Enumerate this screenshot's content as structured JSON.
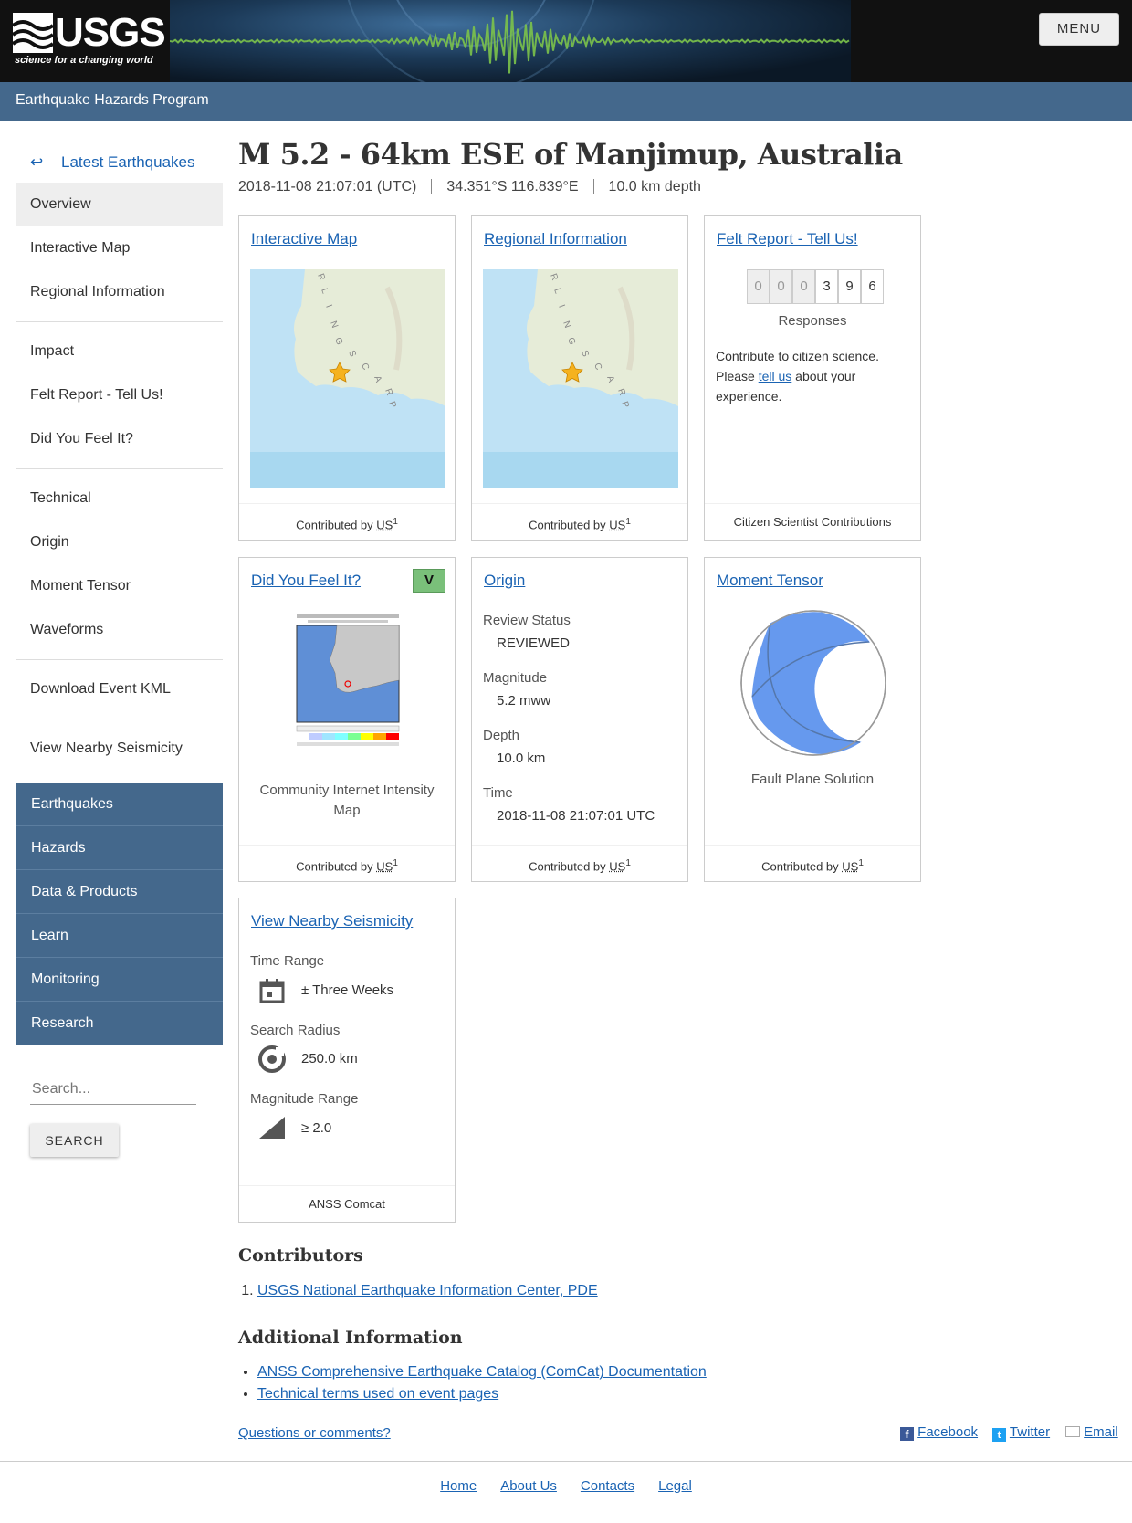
{
  "header": {
    "logo_word": "USGS",
    "logo_tagline": "science for a changing world",
    "menu_label": "MENU",
    "program": "Earthquake Hazards Program"
  },
  "sidebar": {
    "back_label": "Latest Earthquakes",
    "groups": [
      [
        "Overview",
        "Interactive Map",
        "Regional Information"
      ],
      [
        "Impact",
        "Felt Report - Tell Us!",
        "Did You Feel It?"
      ],
      [
        "Technical",
        "Origin",
        "Moment Tensor",
        "Waveforms"
      ],
      [
        "Download Event KML"
      ],
      [
        "View Nearby Seismicity"
      ]
    ],
    "active": "Overview",
    "nav": [
      "Earthquakes",
      "Hazards",
      "Data & Products",
      "Learn",
      "Monitoring",
      "Research"
    ],
    "search_placeholder": "Search...",
    "search_button": "SEARCH"
  },
  "event": {
    "title": "M 5.2 - 64km ESE of Manjimup, Australia",
    "time": "2018-11-08 21:07:01 (UTC)",
    "location": "34.351°S 116.839°E",
    "depth": "10.0 km depth"
  },
  "cards": {
    "interactive_map": {
      "title": "Interactive Map",
      "contributed": "Contributed by",
      "net": "US",
      "ref": "1"
    },
    "regional": {
      "title": "Regional Information",
      "contributed": "Contributed by",
      "net": "US",
      "ref": "1"
    },
    "felt": {
      "title": "Felt Report - Tell Us!",
      "digits": [
        "0",
        "0",
        "0",
        "3",
        "9",
        "6"
      ],
      "responses": "Responses",
      "text_a": "Contribute to citizen science.",
      "text_b": "Please ",
      "link": "tell us",
      "text_c": " about your",
      "text_d": "experience.",
      "footer": "Citizen Scientist Contributions"
    },
    "dyfi": {
      "title": "Did You Feel It?",
      "badge": "V",
      "caption_1": "Community Internet Intensity",
      "caption_2": "Map",
      "contributed": "Contributed by",
      "net": "US",
      "ref": "1"
    },
    "origin": {
      "title": "Origin",
      "review_label": "Review Status",
      "review": "REVIEWED",
      "mag_label": "Magnitude",
      "mag": "5.2 mww",
      "depth_label": "Depth",
      "depth": "10.0 km",
      "time_label": "Time",
      "time": "2018-11-08 21:07:01 UTC",
      "contributed": "Contributed by",
      "net": "US",
      "ref": "1"
    },
    "moment": {
      "title": "Moment Tensor",
      "caption": "Fault Plane Solution",
      "contributed": "Contributed by",
      "net": "US",
      "ref": "1"
    },
    "seismicity": {
      "title": "View Nearby Seismicity",
      "time_label": "Time Range",
      "time": "± Three Weeks",
      "radius_label": "Search Radius",
      "radius": "250.0 km",
      "mag_label": "Magnitude Range",
      "mag": "≥ 2.0",
      "footer": "ANSS Comcat"
    }
  },
  "map_labels": [
    "R",
    "L",
    "I",
    "N",
    "G",
    "S",
    "C",
    "A",
    "R",
    "P"
  ],
  "contributors": {
    "heading": "Contributors",
    "items": [
      "USGS National Earthquake Information Center, PDE"
    ]
  },
  "additional": {
    "heading": "Additional Information",
    "items": [
      "ANSS Comprehensive Earthquake Catalog (ComCat) Documentation",
      "Technical terms used on event pages"
    ]
  },
  "questions": "Questions or comments?",
  "share": {
    "facebook": "Facebook",
    "twitter": "Twitter",
    "email": "Email"
  },
  "footer_links": [
    "Home",
    "About Us",
    "Contacts",
    "Legal"
  ],
  "colors": {
    "nav_blue": "#44688c",
    "link": "#1a63b3",
    "map_water": "#a8d8f0",
    "map_land": "#e6ecd8",
    "beachball": "#6699ee"
  }
}
